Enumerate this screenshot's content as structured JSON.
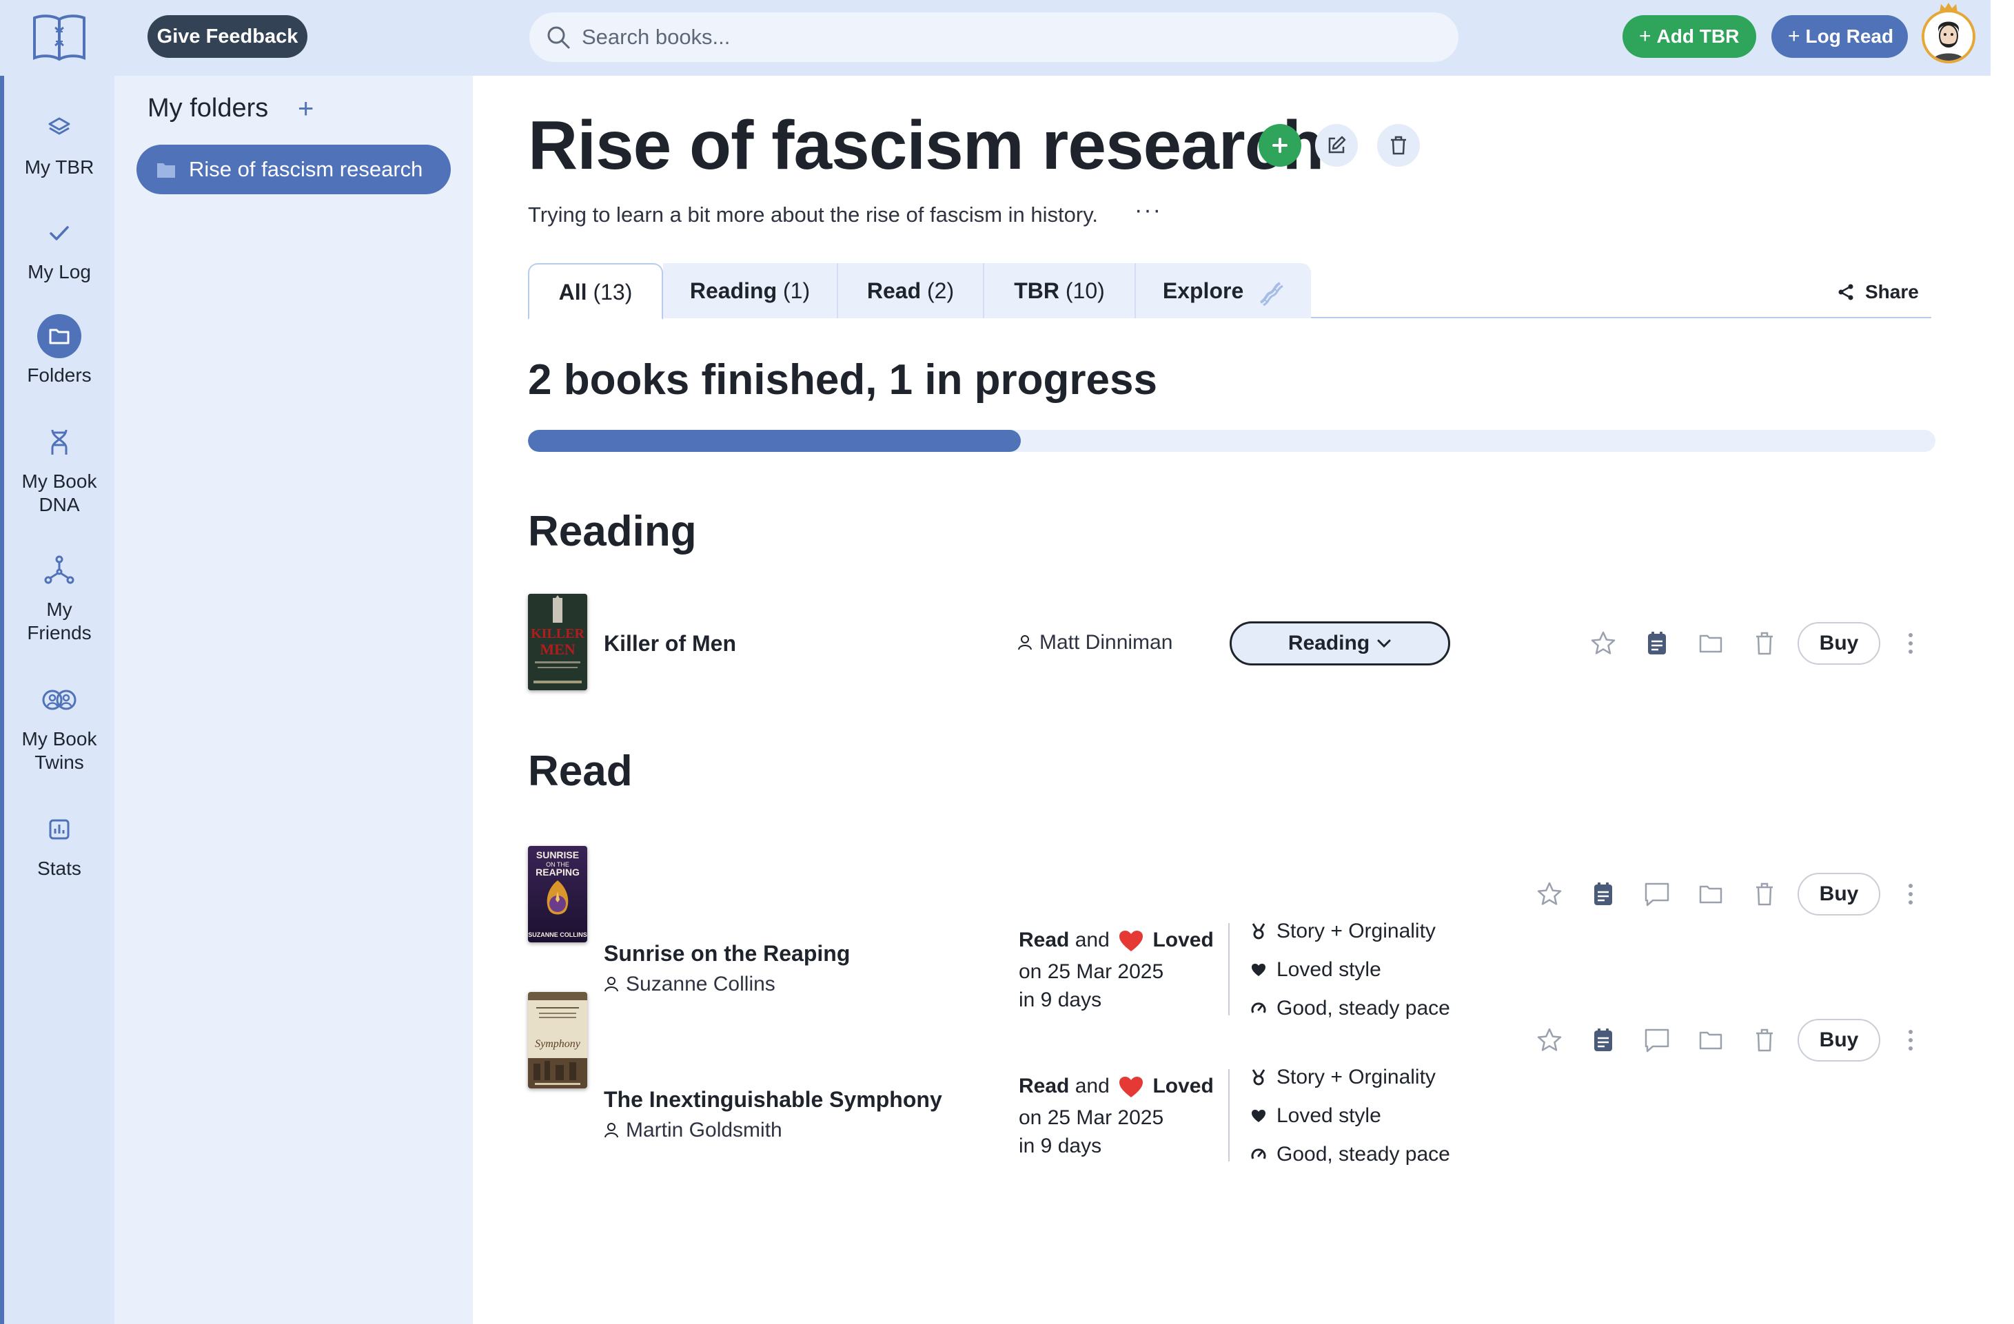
{
  "topbar": {
    "feedback_label": "Give Feedback",
    "search_placeholder": "Search books...",
    "add_tbr_label": "Add TBR",
    "log_read_label": "Log Read"
  },
  "nav": {
    "items": [
      {
        "label": "My TBR",
        "icon": "layers-icon"
      },
      {
        "label": "My Log",
        "icon": "check-icon"
      },
      {
        "label": "Folders",
        "icon": "folder-icon",
        "active": true
      },
      {
        "label": "My Book DNA",
        "icon": "dna-icon"
      },
      {
        "label": "My Friends",
        "icon": "network-icon"
      },
      {
        "label": "My Book Twins",
        "icon": "twins-icon"
      },
      {
        "label": "Stats",
        "icon": "stats-icon"
      }
    ]
  },
  "folders": {
    "title": "My folders",
    "add_symbol": "+",
    "items": [
      {
        "label": "Rise of fascism research",
        "active": true
      }
    ]
  },
  "page": {
    "title": "Rise of fascism research",
    "description": "Trying to learn a bit more about the rise of fascism in history.",
    "more": "···",
    "tabs": [
      {
        "label": "All",
        "count": "(13)",
        "active": true
      },
      {
        "label": "Reading",
        "count": "(1)"
      },
      {
        "label": "Read",
        "count": "(2)"
      },
      {
        "label": "TBR",
        "count": "(10)"
      },
      {
        "label": "Explore",
        "count": ""
      }
    ],
    "share_label": "Share",
    "summary": "2 books finished, 1 in progress",
    "progress_fraction": 0.35
  },
  "sections": {
    "reading": {
      "title": "Reading",
      "books": [
        {
          "title": "Killer of Men",
          "author": "Matt Dinniman",
          "status": "Reading",
          "buy": "Buy"
        }
      ]
    },
    "read": {
      "title": "Read",
      "books": [
        {
          "title": "Sunrise on the Reaping",
          "author": "Suzanne Collins",
          "status_read": "Read",
          "status_and": "and",
          "status_loved": "Loved",
          "date": "on 25 Mar 2025",
          "duration": "in 9 days",
          "tags": [
            "Story + Orginality",
            "Loved style",
            "Good, steady pace"
          ],
          "buy": "Buy"
        },
        {
          "title": "The Inextinguishable Symphony",
          "author": "Martin Goldsmith",
          "status_read": "Read",
          "status_and": "and",
          "status_loved": "Loved",
          "date": "on 25 Mar 2025",
          "duration": "in 9 days",
          "tags": [
            "Story + Orginality",
            "Loved style",
            "Good, steady pace"
          ],
          "buy": "Buy"
        }
      ]
    }
  },
  "colors": {
    "accent": "#4f72b8",
    "green": "#2fa55c",
    "nav_bg": "#dbe6f8",
    "panel_bg": "#eaf0fb",
    "dark": "#1e232c",
    "heart": "#e53935"
  }
}
